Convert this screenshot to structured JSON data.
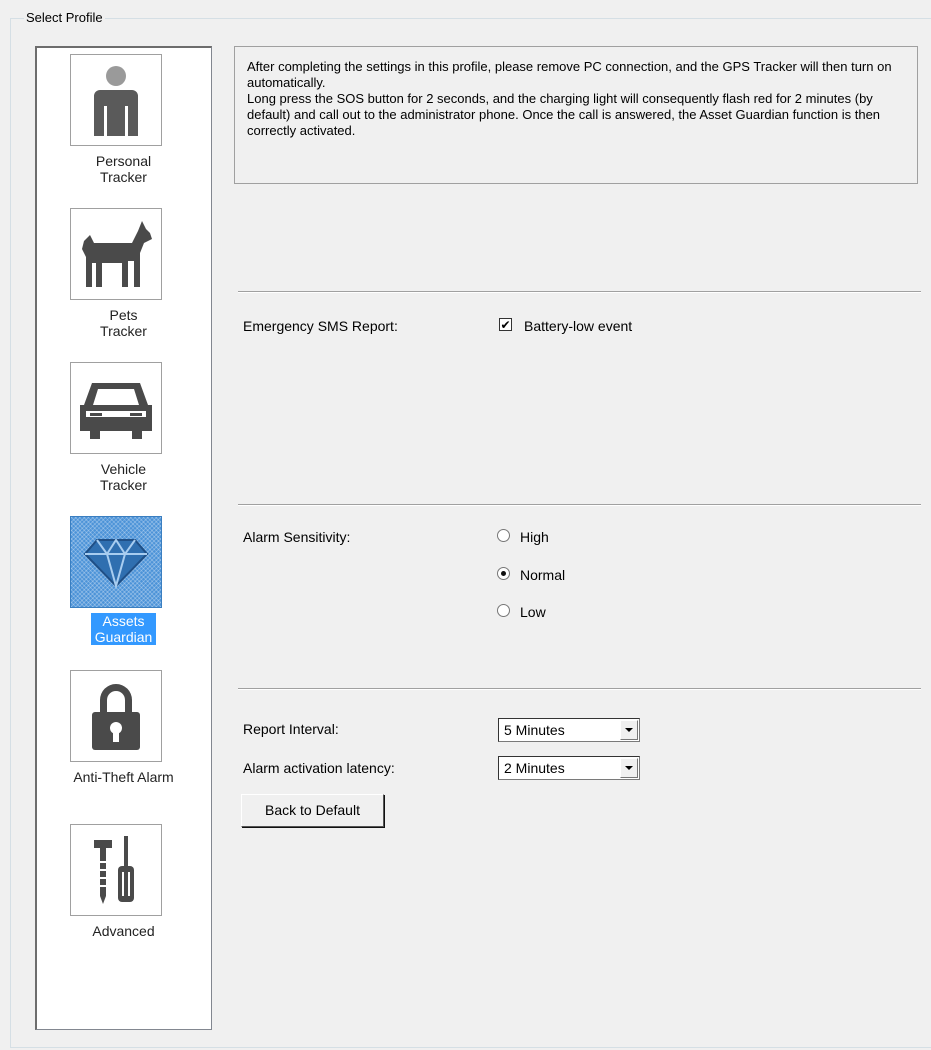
{
  "group": {
    "title": "Select Profile"
  },
  "profiles": [
    {
      "label_line1": "Personal",
      "label_line2": "Tracker",
      "icon": "person-icon"
    },
    {
      "label_line1": "Pets",
      "label_line2": "Tracker",
      "icon": "dog-icon"
    },
    {
      "label_line1": "Vehicle",
      "label_line2": "Tracker",
      "icon": "car-icon"
    },
    {
      "label_line1": "Assets",
      "label_line2": "Guardian",
      "icon": "diamond-icon",
      "selected": true
    },
    {
      "label_line1": "Anti-Theft Alarm",
      "label_line2": "",
      "icon": "padlock-icon"
    },
    {
      "label_line1": "Advanced",
      "label_line2": "",
      "icon": "tools-icon"
    }
  ],
  "info": {
    "line1": "After completing the settings in this profile, please remove PC connection, and the GPS Tracker will then turn on automatically.",
    "line2": "Long press the SOS button for 2 seconds, and the charging light will consequently flash red for 2 minutes (by default) and call out to the administrator phone. Once the call is answered, the Asset Guardian function is then correctly activated."
  },
  "emergency": {
    "label": "Emergency SMS Report:",
    "checkbox_label": "Battery-low event",
    "checked": true
  },
  "sensitivity": {
    "label": "Alarm Sensitivity:",
    "options": [
      "High",
      "Normal",
      "Low"
    ],
    "selected": "Normal"
  },
  "report_interval": {
    "label": "Report Interval:",
    "value": "5 Minutes"
  },
  "alarm_latency": {
    "label": "Alarm activation latency:",
    "value": "2 Minutes"
  },
  "actions": {
    "back_to_default": "Back to Default"
  },
  "colors": {
    "selection": "#3399ff",
    "background": "#f0f0f0"
  }
}
